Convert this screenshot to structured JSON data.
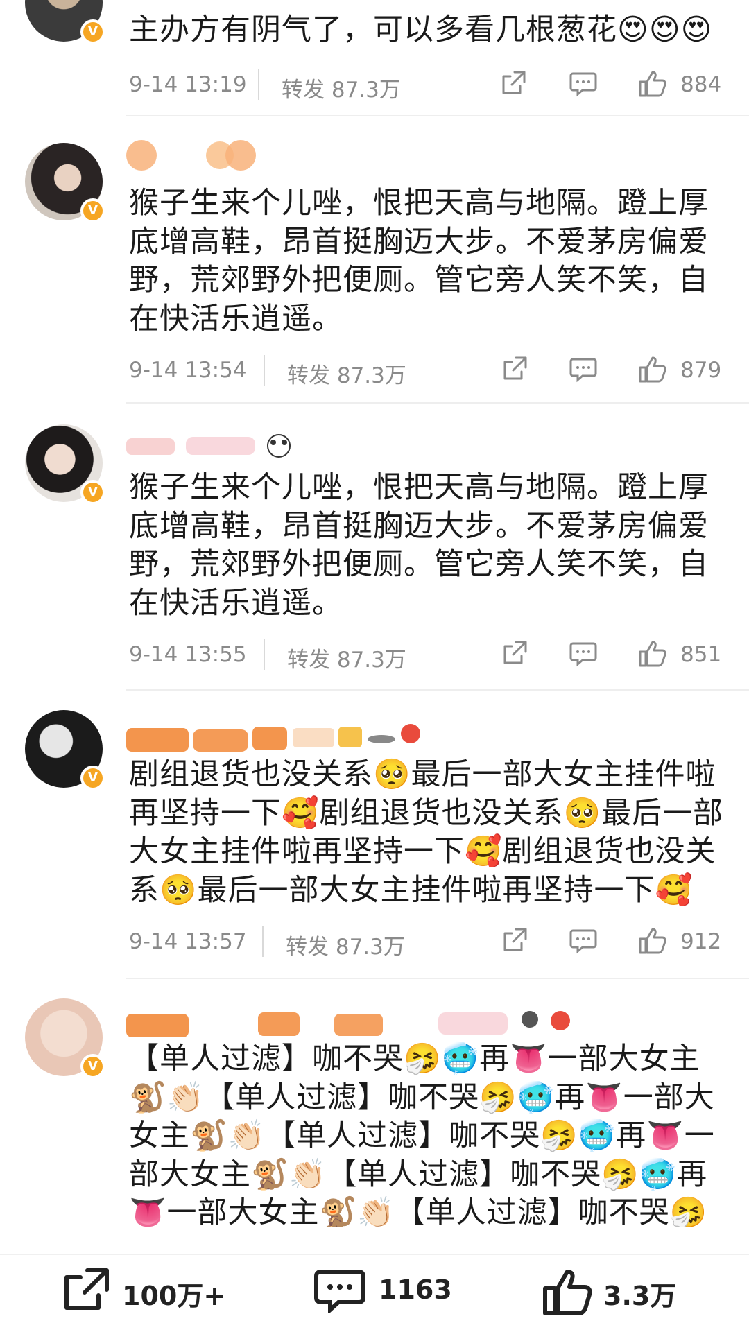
{
  "comments": [
    {
      "text": "主办方有阴气了，可以多看几根葱花😍😍😍",
      "time": "9-14 13:19",
      "repost": "转发 87.3万",
      "likes": "884"
    },
    {
      "text": "猴子生来个儿唑，恨把天高与地隔。蹬上厚底增高鞋，昂首挺胸迈大步。不爱茅房偏爱野，荒郊野外把便厕。管它旁人笑不笑，自在快活乐逍遥。",
      "time": "9-14 13:54",
      "repost": "转发 87.3万",
      "likes": "879"
    },
    {
      "text": "猴子生来个儿唑，恨把天高与地隔。蹬上厚底增高鞋，昂首挺胸迈大步。不爱茅房偏爱野，荒郊野外把便厕。管它旁人笑不笑，自在快活乐逍遥。",
      "time": "9-14 13:55",
      "repost": "转发 87.3万",
      "likes": "851"
    },
    {
      "text": "剧组退货也没关系🥺最后一部大女主挂件啦再坚持一下🥰剧组退货也没关系🥺最后一部大女主挂件啦再坚持一下🥰剧组退货也没关系🥺最后一部大女主挂件啦再坚持一下🥰",
      "time": "9-14 13:57",
      "repost": "转发 87.3万",
      "likes": "912"
    },
    {
      "text": "【单人过滤】咖不哭🤧🥶再👅一部大女主🐒👏🏻【单人过滤】咖不哭🤧🥶再👅一部大女主🐒👏🏻【单人过滤】咖不哭🤧🥶再👅一部大女主🐒👏🏻【单人过滤】咖不哭🤧🥶再👅一部大女主🐒👏🏻【单人过滤】咖不哭🤧"
    }
  ],
  "bottom_bar": {
    "share_count": "100万+",
    "comment_count": "1163",
    "like_count": "3.3万"
  },
  "colors": {
    "verified_badge": "#f6a623",
    "meta_gray": "#8a8a8a",
    "blur_orange": "#f28a3a"
  }
}
